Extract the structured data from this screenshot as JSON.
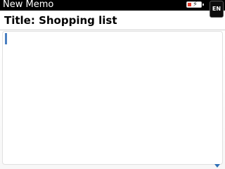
{
  "statusbar": {
    "app_title": "New Memo",
    "battery_icon": "battery-charging-icon",
    "battery_level_color": "#e23b2a",
    "language_badge": "EN"
  },
  "memo": {
    "title_field": "Title: Shopping list",
    "body_text": ""
  },
  "scroll_indicator_icon": "chevron-down-icon",
  "accent_color": "#4a7fc1"
}
